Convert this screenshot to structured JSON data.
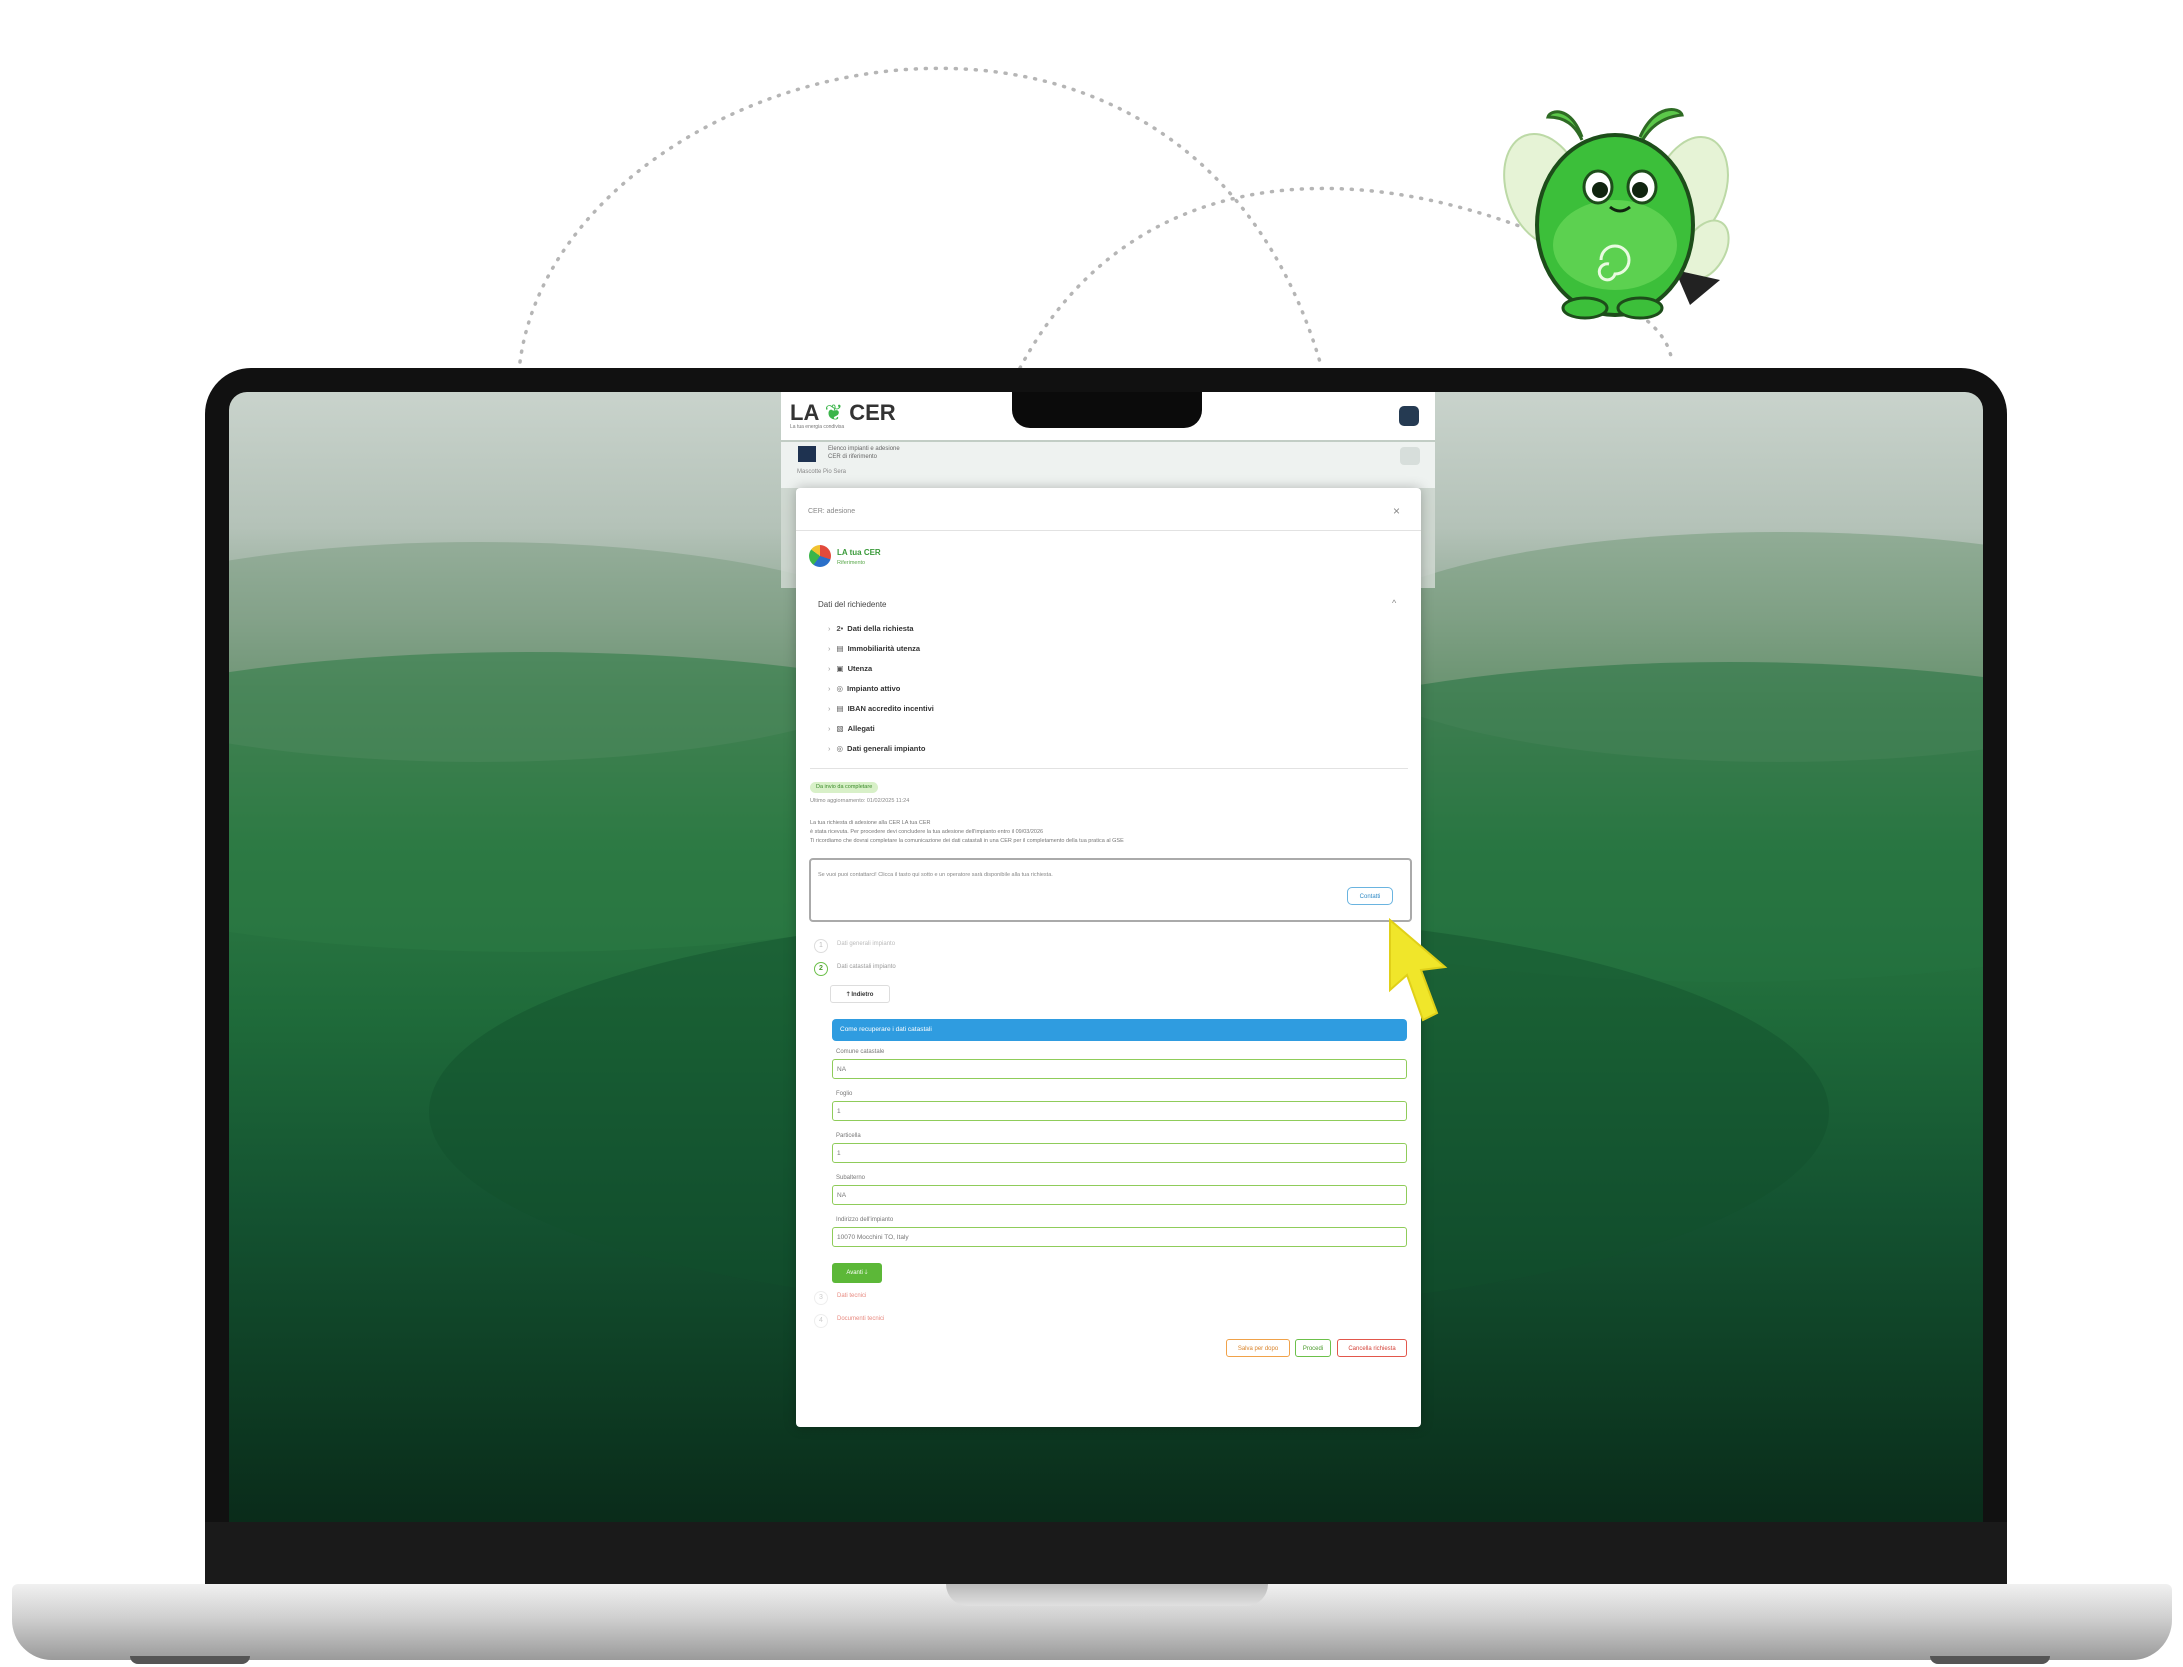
{
  "app": {
    "logo_text": "LA",
    "logo_suffix": "CER",
    "tagline": "La tua energia condivisa"
  },
  "plant_card": {
    "line1": "Elenco impianti e adesione",
    "line2": "CER di riferimento",
    "line3": "Mascotte Pio Sera"
  },
  "modal": {
    "title": "CER: adesione",
    "close_label": "×",
    "cer_name": "LA tua CER",
    "cer_sub": "Riferimento",
    "section_title": "Dati del richiedente",
    "collapse_label": "^",
    "accordion": [
      {
        "icon": "2•",
        "label": "Dati della richiesta"
      },
      {
        "icon": "▤",
        "label": "Immobiliarità utenza"
      },
      {
        "icon": "▣",
        "label": "Utenza"
      },
      {
        "icon": "◎",
        "label": "Impianto attivo"
      },
      {
        "icon": "▤",
        "label": "IBAN accredito incentivi"
      },
      {
        "icon": "▧",
        "label": "Allegati"
      },
      {
        "icon": "◎",
        "label": "Dati generali impianto"
      }
    ],
    "status_badge": "Da invio da completare",
    "last_update": "Ultimo aggiornamento: 01/02/2025 11:24",
    "info_line1": "La tua richiesta di adesione alla CER LA tua CER",
    "info_line2": "è stata ricevuta. Per procedere devi concludere la tua adesione dell'impianto entro il 09/03/2026",
    "info_line3": "Ti ricordiamo che dovrai completare la comunicazione dei dati catastali in una CER per il completamento della tua pratica al GSE",
    "note_text": "Se vuoi puoi contattarci! Clicca il tasto qui sotto e un operatore sarà disponibile alla tua richiesta.",
    "contact_button": "Contatti",
    "steps": [
      {
        "num": "1",
        "label": "Dati generali impianto"
      },
      {
        "num": "2",
        "label": "Dati catastali impianto"
      }
    ],
    "back_button": "Indietro",
    "info_banner": "Come recuperare i dati catastali",
    "fields": [
      {
        "label": "Comune catastale",
        "value": "NA"
      },
      {
        "label": "Foglio",
        "value": "1"
      },
      {
        "label": "Particella",
        "value": "1"
      },
      {
        "label": "Subalterno",
        "value": "NA"
      },
      {
        "label": "Indirizzo dell'impianto",
        "value": "10070 Mocchini TO, Italy"
      }
    ],
    "next_button": "Avanti",
    "later_steps": [
      {
        "num": "3",
        "label": "Dati tecnici"
      },
      {
        "num": "4",
        "label": "Documenti tecnici"
      }
    ],
    "footer_buttons": {
      "save": "Salva per dopo",
      "proceed": "Procedi",
      "cancel": "Cancella richiesta"
    }
  },
  "colors": {
    "accent_green": "#6cc04a",
    "info_blue": "#2f9ce0",
    "cancel_red": "#e2574c",
    "save_orange": "#f0a24a",
    "cursor_yellow": "#f0e62a"
  }
}
